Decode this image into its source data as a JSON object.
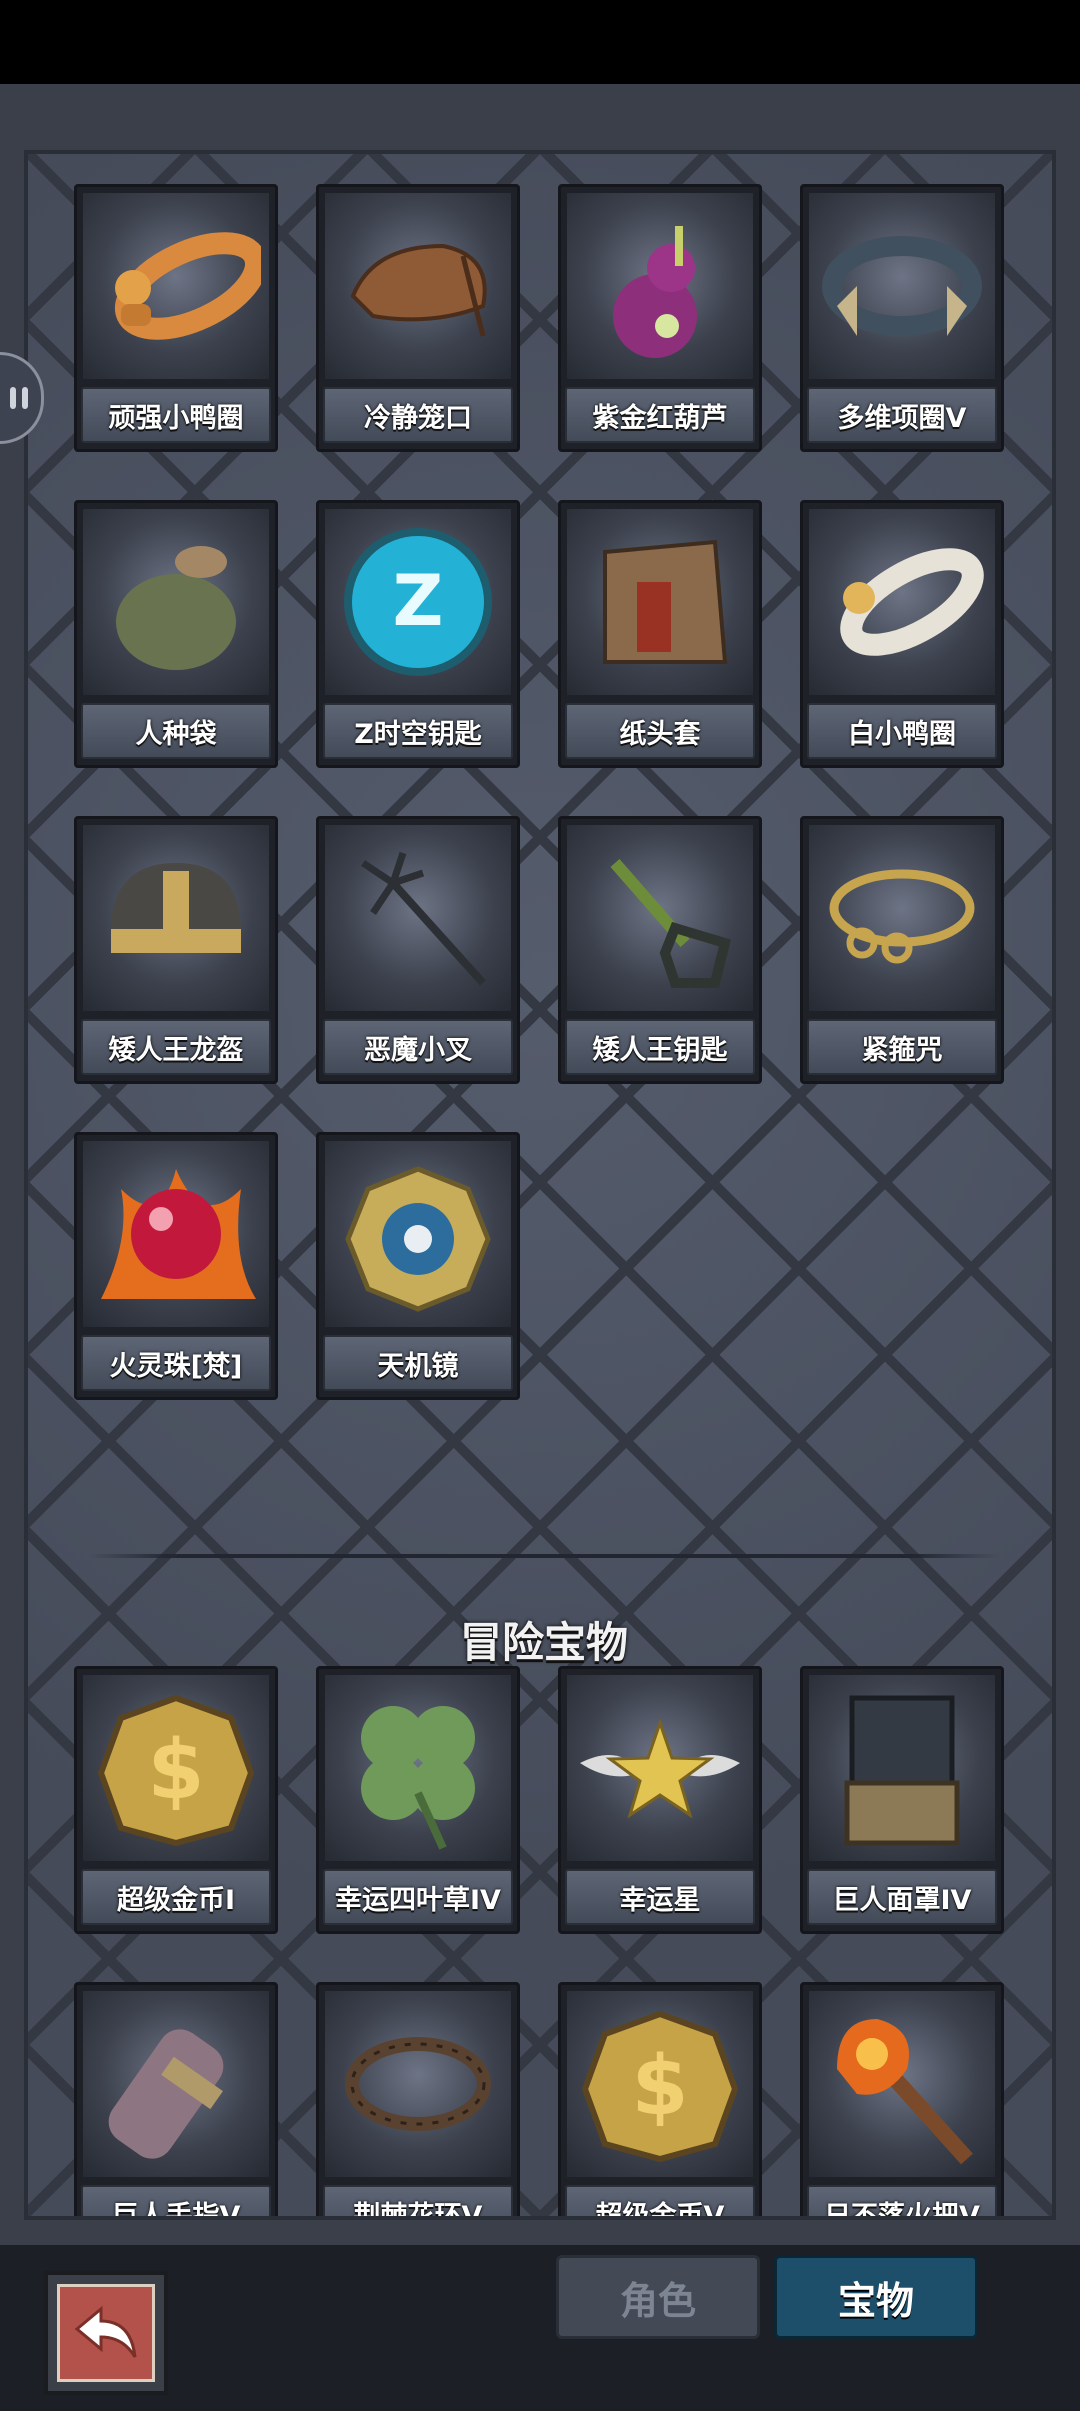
{
  "items": [
    {
      "name": "顽强小鸭圈",
      "icon": "orange-duck-ring-icon"
    },
    {
      "name": "冷静笼口",
      "icon": "leather-muzzle-icon"
    },
    {
      "name": "紫金红葫芦",
      "icon": "purple-gourd-icon"
    },
    {
      "name": "多维项圈V",
      "icon": "spiked-collar-icon"
    },
    {
      "name": "人种袋",
      "icon": "cloth-sack-icon"
    },
    {
      "name": "Z时空钥匙",
      "icon": "z-orb-key-icon"
    },
    {
      "name": "纸头套",
      "icon": "paper-bag-mask-icon"
    },
    {
      "name": "白小鸭圈",
      "icon": "white-duck-ring-icon"
    },
    {
      "name": "矮人王龙盔",
      "icon": "dwarf-helmet-icon"
    },
    {
      "name": "恶魔小叉",
      "icon": "trident-icon"
    },
    {
      "name": "矮人王钥匙",
      "icon": "dwarf-key-icon"
    },
    {
      "name": "紧箍咒",
      "icon": "golden-headband-icon"
    },
    {
      "name": "火灵珠[梵]",
      "icon": "fire-orb-icon"
    },
    {
      "name": "天机镜",
      "icon": "bagua-mirror-icon"
    }
  ],
  "section_title": "冒险宝物",
  "adventure_items": [
    {
      "name": "超级金币I",
      "icon": "gold-coin-icon"
    },
    {
      "name": "幸运四叶草IV",
      "icon": "four-leaf-clover-icon"
    },
    {
      "name": "幸运星",
      "icon": "winged-star-icon"
    },
    {
      "name": "巨人面罩IV",
      "icon": "giant-mask-icon"
    },
    {
      "name": "巨人手指V",
      "icon": "giant-finger-icon"
    },
    {
      "name": "荆棘花环V",
      "icon": "thorn-wreath-icon"
    },
    {
      "name": "超级金币V",
      "icon": "gold-coin-icon"
    },
    {
      "name": "日不落火把V",
      "icon": "torch-icon"
    }
  ],
  "tabs": {
    "role": "角色",
    "treasure": "宝物",
    "active": "宝物"
  },
  "colors": {
    "panel": "#4a5060",
    "card": "#1e2128",
    "active_tab": "#1d4f6a",
    "back_button": "#b3524a"
  }
}
